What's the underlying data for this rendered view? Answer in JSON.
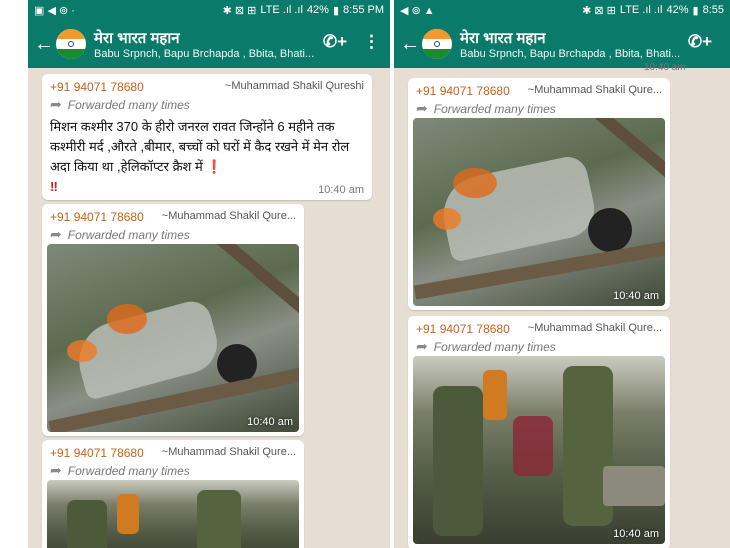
{
  "left": {
    "status": {
      "left_icons": "▣ ◀ ⊚ ·",
      "right_icons": "✱ ⊠ ⊞",
      "network": "LTE .ıl .ıl",
      "battery": "42%",
      "time": "8:55 PM"
    },
    "chat": {
      "title": "मेरा भारत महान",
      "members": "Babu Srpnch, Bapu Brchapda , Bbita, Bhati..."
    },
    "messages": [
      {
        "phone": "+91 94071 78680",
        "sender": "~Muhammad Shakil Qureshi",
        "forwarded": "Forwarded many times",
        "text": "मिशन कश्मीर 370 के हीरो जनरल रावत जिन्होंने 6 महीने तक कश्मीरी मर्द ,औरते ,बीमार, बच्चों को घरों में कैद रखने में मेन रोल अदा किया था ,हेलिकॉप्टर क्रैश में",
        "excl1": "❗",
        "excl2": "‼",
        "time": "10:40 am"
      },
      {
        "phone": "+91 94071 78680",
        "sender": "~Muhammad Shakil Qure...",
        "forwarded": "Forwarded many times",
        "time": "10:40 am"
      },
      {
        "phone": "+91 94071 78680",
        "sender": "~Muhammad Shakil Qure...",
        "forwarded": "Forwarded many times"
      }
    ]
  },
  "right": {
    "status": {
      "left_icons": "◀ ⊚ ▲",
      "right_icons": "✱ ⊠ ⊞",
      "network": "LTE .ıl .ıl",
      "battery": "42%",
      "time": "8:55"
    },
    "chat": {
      "title": "मेरा भारत महान",
      "members": "Babu Srpnch, Bapu Brchapda , Bbita, Bhati..."
    },
    "clipped_time": "10:40 am",
    "messages": [
      {
        "phone": "+91 94071 78680",
        "sender": "~Muhammad Shakil Qure...",
        "forwarded": "Forwarded many times",
        "time": "10:40 am"
      },
      {
        "phone": "+91 94071 78680",
        "sender": "~Muhammad Shakil Qure...",
        "forwarded": "Forwarded many times",
        "time": "10:40 am"
      }
    ]
  },
  "icons": {
    "back": "←",
    "call_add": "✆+",
    "menu": "⋮",
    "forward": "➦"
  },
  "colors": {
    "header": "#0a7a6a",
    "chat_bg": "#e6ded3",
    "phone": "#c4621b"
  }
}
